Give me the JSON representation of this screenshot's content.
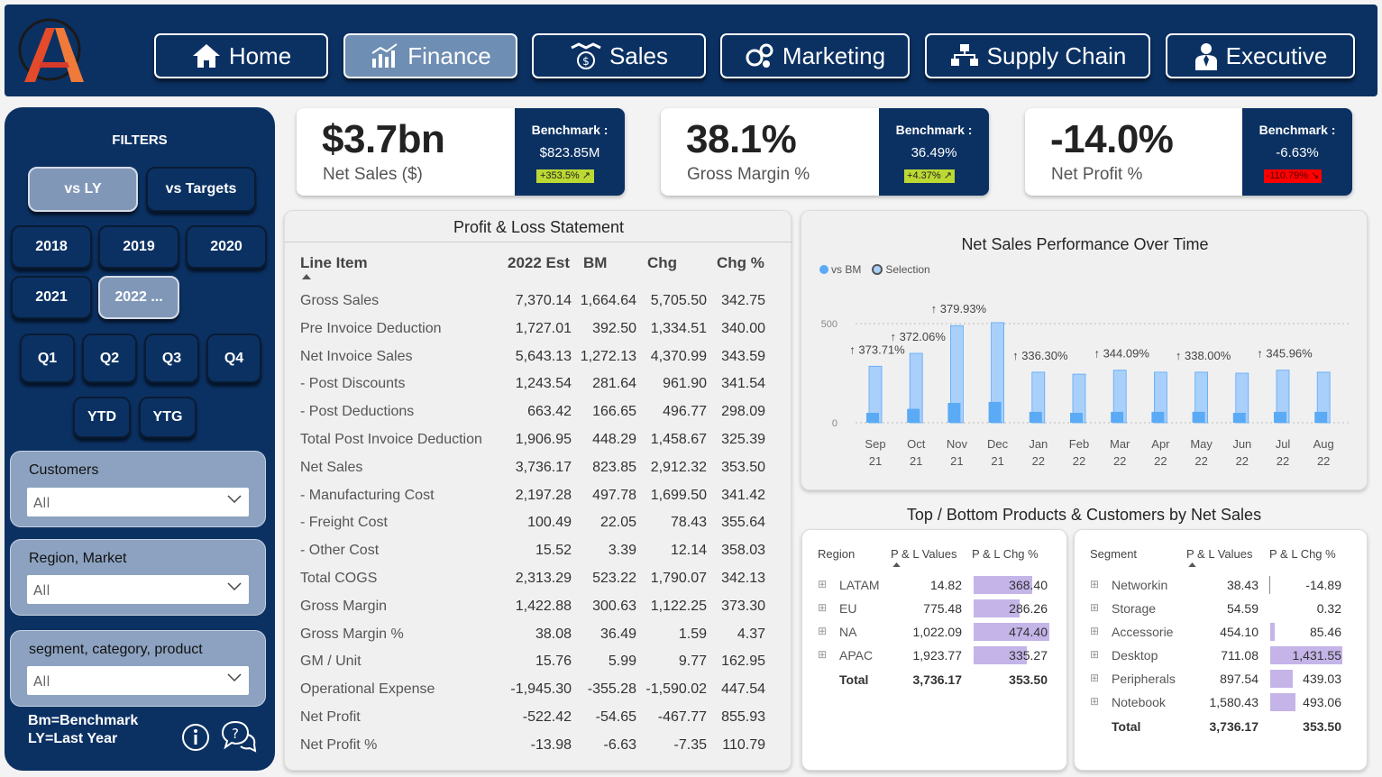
{
  "nav": {
    "home": "Home",
    "finance": "Finance",
    "sales": "Sales",
    "marketing": "Marketing",
    "supply_chain": "Supply Chain",
    "executive": "Executive",
    "active": "Finance"
  },
  "sidebar": {
    "title": "FILTERS",
    "compare": [
      "vs LY",
      "vs Targets"
    ],
    "compare_selected": "vs LY",
    "years": [
      "2018",
      "2019",
      "2020",
      "2021",
      "2022 ..."
    ],
    "year_selected": "2022 ...",
    "quarters": [
      "Q1",
      "Q2",
      "Q3",
      "Q4"
    ],
    "periods": [
      "YTD",
      "YTG"
    ],
    "slicers": [
      {
        "title": "Customers",
        "value": "All"
      },
      {
        "title": "Region, Market",
        "value": "All"
      },
      {
        "title": "segment, category, product",
        "value": "All"
      }
    ],
    "note_line1": "Bm=Benchmark",
    "note_line2": "LY=Last Year"
  },
  "kpis": [
    {
      "value": "$3.7bn",
      "label": "Net Sales ($)",
      "bm_title": "Benchmark :",
      "bm_value": "$823.85M",
      "change": "+353.5%",
      "direction": "up"
    },
    {
      "value": "38.1%",
      "label": "Gross Margin %",
      "bm_title": "Benchmark :",
      "bm_value": "36.49%",
      "change": "+4.37%",
      "direction": "up"
    },
    {
      "value": "-14.0%",
      "label": "Net Profit %",
      "bm_title": "Benchmark :",
      "bm_value": "-6.63%",
      "change": "-110.79%",
      "direction": "down"
    }
  ],
  "pl": {
    "title": "Profit & Loss Statement",
    "headers": [
      "Line Item",
      "2022 Est",
      "BM",
      "Chg",
      "Chg %"
    ],
    "rows": [
      [
        "Gross Sales",
        "7,370.14",
        "1,664.64",
        "5,705.50",
        "342.75"
      ],
      [
        "Pre Invoice Deduction",
        "1,727.01",
        "392.50",
        "1,334.51",
        "340.00"
      ],
      [
        "Net Invoice Sales",
        "5,643.13",
        "1,272.13",
        "4,370.99",
        "343.59"
      ],
      [
        "- Post Discounts",
        "1,243.54",
        "281.64",
        "961.90",
        "341.54"
      ],
      [
        "- Post Deductions",
        "663.42",
        "166.65",
        "496.77",
        "298.09"
      ],
      [
        "Total Post Invoice Deduction",
        "1,906.95",
        "448.29",
        "1,458.67",
        "325.39"
      ],
      [
        "Net Sales",
        "3,736.17",
        "823.85",
        "2,912.32",
        "353.50"
      ],
      [
        "- Manufacturing Cost",
        "2,197.28",
        "497.78",
        "1,699.50",
        "341.42"
      ],
      [
        "- Freight Cost",
        "100.49",
        "22.05",
        "78.43",
        "355.64"
      ],
      [
        "- Other Cost",
        "15.52",
        "3.39",
        "12.14",
        "358.03"
      ],
      [
        "Total COGS",
        "2,313.29",
        "523.22",
        "1,790.07",
        "342.13"
      ],
      [
        "Gross Margin",
        "1,422.88",
        "300.63",
        "1,122.25",
        "373.30"
      ],
      [
        "Gross Margin %",
        "38.08",
        "36.49",
        "1.59",
        "4.37"
      ],
      [
        "GM / Unit",
        "15.76",
        "5.99",
        "9.77",
        "162.95"
      ],
      [
        "Operational Expense",
        "-1,945.30",
        "-355.28",
        "-1,590.02",
        "447.54"
      ],
      [
        "Net Profit",
        "-522.42",
        "-54.65",
        "-467.77",
        "855.93"
      ],
      [
        "Net Profit %",
        "-13.98",
        "-6.63",
        "-7.35",
        "110.79"
      ]
    ]
  },
  "chart_data": {
    "type": "bar",
    "title": "Net Sales Performance Over Time",
    "legend": [
      "vs BM",
      "Selection"
    ],
    "categories": [
      "Sep 21",
      "Oct 21",
      "Nov 21",
      "Dec 21",
      "Jan 22",
      "Feb 22",
      "Mar 22",
      "Apr 22",
      "May 22",
      "Jun 22",
      "Jul 22",
      "Aug 22"
    ],
    "series": [
      {
        "name": "vs BM",
        "values": [
          50,
          70,
          100,
          105,
          55,
          50,
          55,
          55,
          55,
          50,
          55,
          55
        ]
      },
      {
        "name": "Selection",
        "values": [
          285,
          350,
          490,
          505,
          255,
          245,
          265,
          255,
          255,
          250,
          265,
          255
        ]
      }
    ],
    "annotations": [
      "↑ 373.71%",
      "↑ 372.06%",
      "↑ 379.93%",
      "",
      "↑ 336.30%",
      "",
      "↑ 344.09%",
      "",
      "↑ 338.00%",
      "",
      "↑ 345.96%",
      ""
    ],
    "yticks": [
      "0",
      "500"
    ],
    "ylim": [
      0,
      560
    ],
    "colors": {
      "vs_bm": "#5aaaf5",
      "selection": "#a9cffb"
    }
  },
  "bottom_title": "Top / Bottom Products & Customers by Net Sales",
  "region_table": {
    "headers": [
      "Region",
      "P & L Values",
      "P & L Chg %"
    ],
    "rows": [
      {
        "name": "LATAM",
        "value": "14.82",
        "chg": "368.40",
        "pct": 368.4
      },
      {
        "name": "EU",
        "value": "775.48",
        "chg": "286.26",
        "pct": 286.26
      },
      {
        "name": "NA",
        "value": "1,022.09",
        "chg": "474.40",
        "pct": 474.4
      },
      {
        "name": "APAC",
        "value": "1,923.77",
        "chg": "335.27",
        "pct": 335.27
      }
    ],
    "total_label": "Total",
    "total_value": "3,736.17",
    "total_chg": "353.50"
  },
  "segment_table": {
    "headers": [
      "Segment",
      "P & L Values",
      "P & L Chg %"
    ],
    "rows": [
      {
        "name": "Networkin",
        "value": "38.43",
        "chg": "-14.89",
        "pct": -14.89
      },
      {
        "name": "Storage",
        "value": "54.59",
        "chg": "0.32",
        "pct": 0.32
      },
      {
        "name": "Accessorie",
        "value": "454.10",
        "chg": "85.46",
        "pct": 85.46
      },
      {
        "name": "Desktop",
        "value": "711.08",
        "chg": "1,431.55",
        "pct": 1431.55
      },
      {
        "name": "Peripherals",
        "value": "897.54",
        "chg": "439.03",
        "pct": 439.03
      },
      {
        "name": "Notebook",
        "value": "1,580.43",
        "chg": "493.06",
        "pct": 493.06
      }
    ],
    "total_label": "Total",
    "total_value": "3,736.17",
    "total_chg": "353.50"
  }
}
